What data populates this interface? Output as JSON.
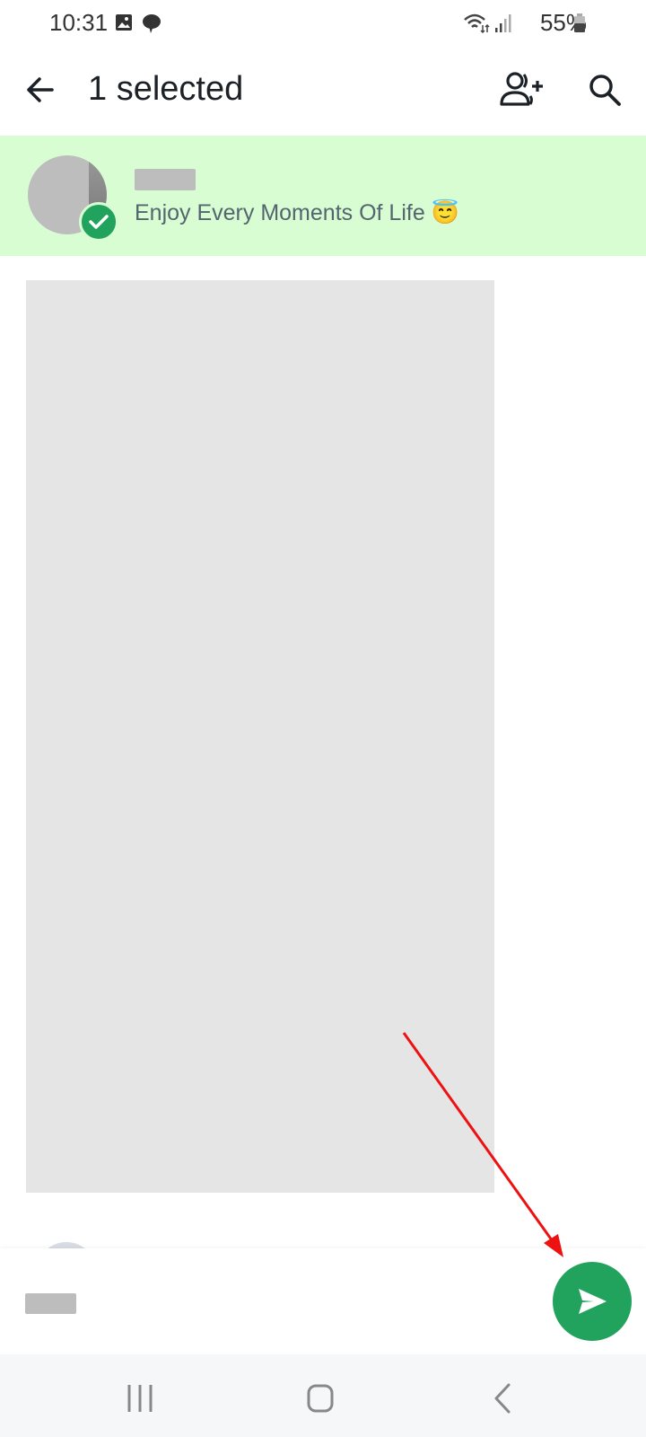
{
  "status_bar": {
    "time": "10:31",
    "left_icons": [
      "gallery-icon",
      "chat-bubble-icon"
    ],
    "right_icons": [
      "wifi-icon",
      "signal-icon",
      "battery-icon"
    ],
    "battery_percent": "55%"
  },
  "app_bar": {
    "title": "1 selected",
    "back_icon": "arrow-back-icon",
    "actions": [
      {
        "name": "add-contact",
        "icon": "person-add-icon"
      },
      {
        "name": "search",
        "icon": "search-icon"
      }
    ]
  },
  "selected_contact": {
    "name": "",
    "name_redacted": true,
    "about": "Enjoy Every Moments Of Life 😇",
    "selected": true,
    "highlight_color": "#d9fdd3",
    "check_color": "#21a35e"
  },
  "contact_list": {
    "redacted": true
  },
  "bottom_bar": {
    "selected_names_redacted": true,
    "send_button_icon": "send-icon",
    "send_button_color": "#21a35e"
  },
  "annotation": {
    "type": "arrow",
    "color": "#ee1111",
    "points_to": "send-button"
  },
  "nav_bar": {
    "buttons": [
      "recent-apps",
      "home",
      "back"
    ]
  }
}
